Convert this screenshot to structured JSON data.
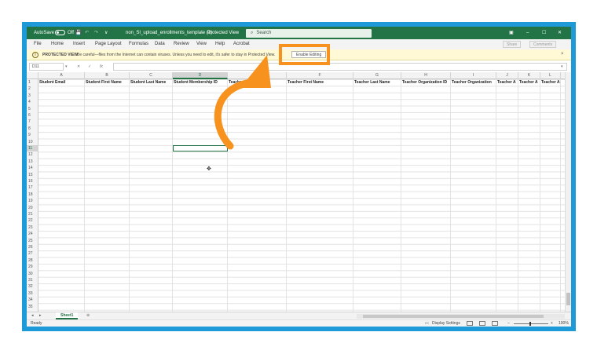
{
  "titlebar": {
    "autosave_label": "AutoSave",
    "autosave_state": "Off",
    "file_name": "non_SI_upload_enrollments_template (1)",
    "mode": "Protected View",
    "search_placeholder": "Search",
    "minimize": "–",
    "restore": "☐",
    "close": "✕",
    "ribbon_display": "▣",
    "save_icon": "💾",
    "undo_icon": "↶",
    "redo_icon": "↷",
    "more_icon": "∨"
  },
  "menu": {
    "tabs": [
      "File",
      "Home",
      "Insert",
      "Page Layout",
      "Formulas",
      "Data",
      "Review",
      "View",
      "Help",
      "Acrobat"
    ],
    "share_label": "Share",
    "comments_label": "Comments"
  },
  "protected_view": {
    "title": "PROTECTED VIEW",
    "message": "Be careful—files from the Internet can contain viruses. Unless you need to edit, it's safer to stay in Protected View.",
    "button": "Enable Editing",
    "close": "×",
    "info_icon": "i"
  },
  "formula_bar": {
    "cell_ref": "D11",
    "fx": "fx",
    "cancel": "✕",
    "enter": "✓",
    "value": ""
  },
  "columns": [
    "A",
    "B",
    "C",
    "D",
    "E",
    "F",
    "G",
    "H",
    "I",
    "J",
    "K",
    "L"
  ],
  "selected_column": "D",
  "selected_row": 11,
  "rows": [
    1,
    2,
    3,
    4,
    5,
    6,
    7,
    8,
    9,
    10,
    11,
    12,
    13,
    14,
    15,
    16,
    17,
    18,
    19,
    20,
    21,
    22,
    23,
    24,
    25,
    26,
    27,
    28,
    29,
    30,
    31,
    32,
    33,
    34,
    35
  ],
  "header_row": [
    "Student Email",
    "Student First Name",
    "Student Last Name",
    "Student Membership ID",
    "Teacher Email",
    "Teacher First Name",
    "Teacher Last Name",
    "Teacher Organization ID",
    "Teacher Organization",
    "Teacher A",
    "Teacher A",
    "Teacher A"
  ],
  "sheets": [
    "Sheet1"
  ],
  "add_sheet": "⊕",
  "status": {
    "ready": "Ready",
    "display_settings": "Display Settings",
    "zoom": "100%",
    "zoom_minus": "–",
    "zoom_plus": "+"
  },
  "colors": {
    "excel_green": "#227447",
    "annotation_orange": "#f7921e",
    "frame_blue": "#1e9ad8"
  }
}
